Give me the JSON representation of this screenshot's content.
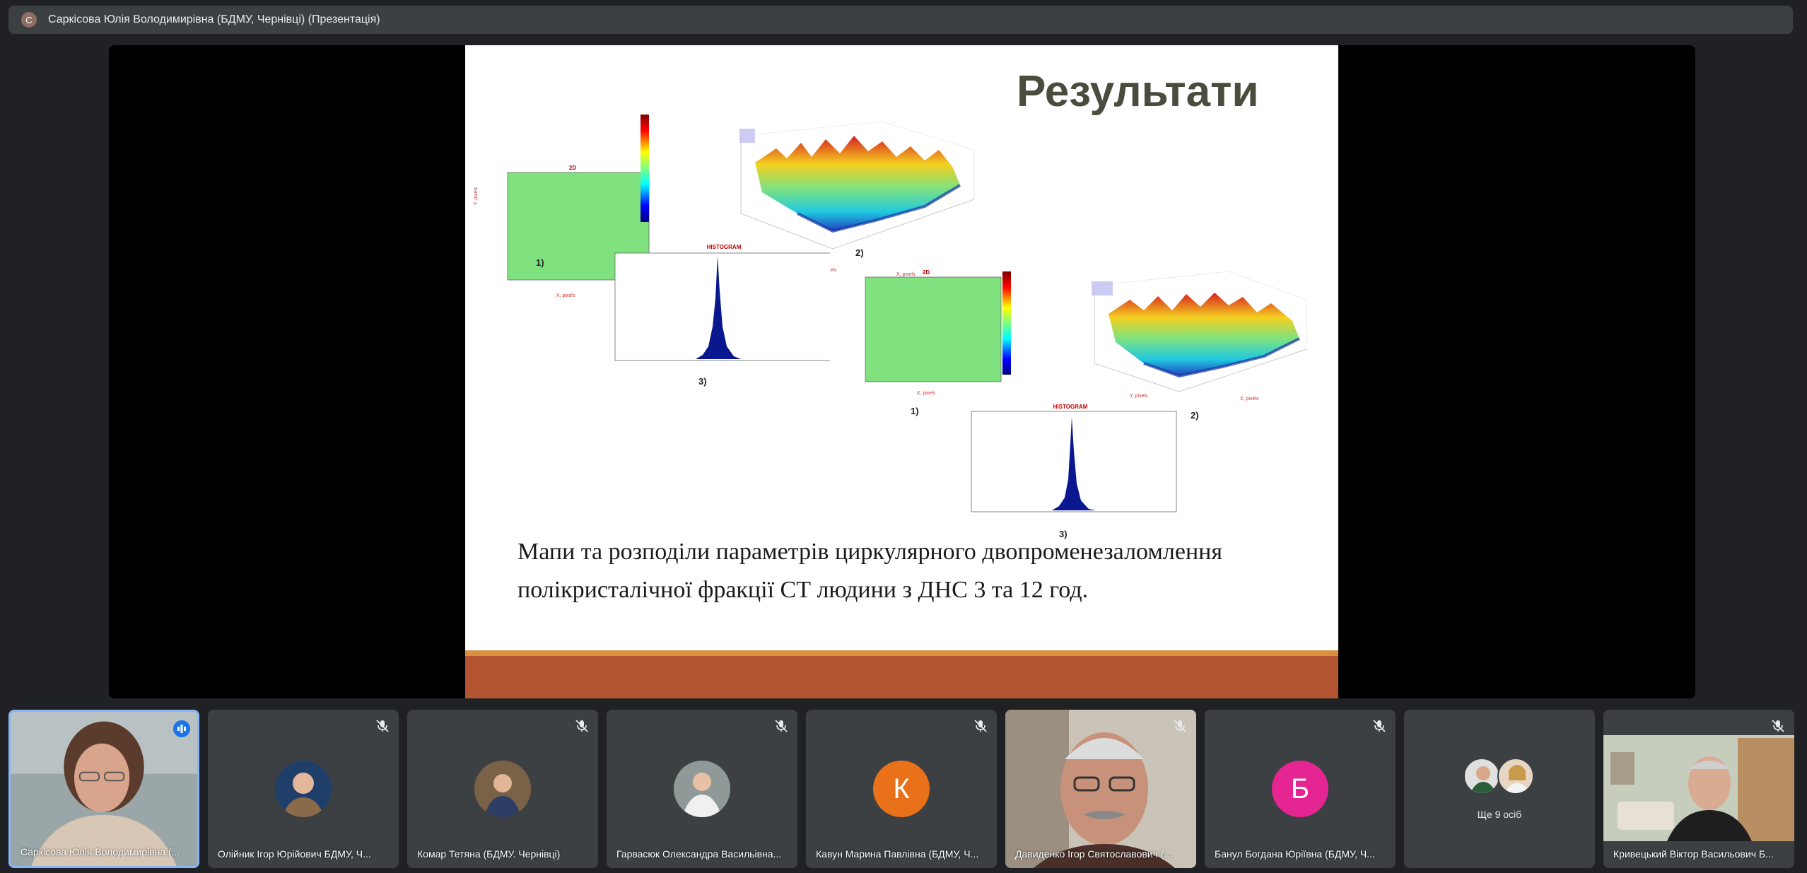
{
  "header": {
    "avatar_letter": "С",
    "title": "Саркісова Юлія Володимирівна (БДМУ, Чернівці) (Презентація)"
  },
  "slide": {
    "title": "Результати",
    "caption_line1": "Мапи та розподіли параметрів циркулярного двопроменезаломлення",
    "caption_line2": "полікристалічної фракції СТ людини з ДНС 3 та 12 год.",
    "figure_labels": {
      "a1": "1)",
      "a2": "2)",
      "a3": "3)",
      "b1": "1)",
      "b2": "2)",
      "b3": "3)"
    },
    "mini": {
      "map_title": "2D",
      "hist_title": "HISTOGRAM",
      "x_pixels": "X, pixels",
      "y_pixels": "Y, pixels"
    },
    "colors": {
      "band": "#b35530",
      "band_top": "#d7913f",
      "title": "#4b4b3e"
    }
  },
  "participants": [
    {
      "name": "Саркісова Юлія Володимирівна (...",
      "type": "video",
      "status": "speaking",
      "active": true
    },
    {
      "name": "Олійник Ігор Юрійович БДМУ, Ч...",
      "type": "photo",
      "status": "muted",
      "avatar_color": "#1f3f6a"
    },
    {
      "name": "Комар Тетяна (БДМУ. Чернівці)",
      "type": "photo",
      "status": "muted",
      "avatar_color": "#6b4a2e"
    },
    {
      "name": "Гарвасюк Олександра Васильівна...",
      "type": "photo",
      "status": "muted",
      "avatar_color": "#5f6b6a"
    },
    {
      "name": "Кавун Марина Павлівна (БДМУ, Ч...",
      "type": "letter",
      "letter": "К",
      "status": "muted",
      "avatar_color": "#e8711a"
    },
    {
      "name": "Давиденко Ігор Святославович (...",
      "type": "video",
      "status": "muted"
    },
    {
      "name": "Банул Богдана Юріївна (БДМУ, Ч...",
      "type": "letter",
      "letter": "Б",
      "status": "muted",
      "avatar_color": "#e52592"
    },
    {
      "name": "Ще 9 осіб",
      "type": "more"
    },
    {
      "name": "Кривецький Віктор Васильович Б...",
      "type": "video",
      "status": "muted"
    }
  ]
}
